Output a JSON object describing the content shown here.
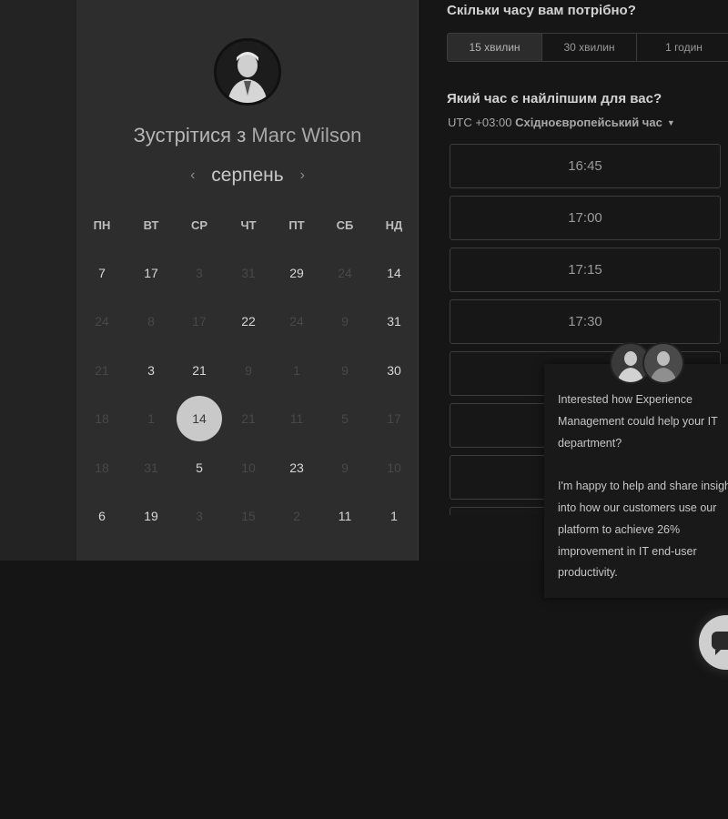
{
  "header": {
    "meet_prefix": "Зустрітися з",
    "host_name": "Marc Wilson"
  },
  "calendar": {
    "month": "серпень",
    "prev_icon": "chevron-left-icon",
    "next_icon": "chevron-right-icon",
    "weekdays": [
      "ПН",
      "ВТ",
      "СР",
      "ЧТ",
      "ПТ",
      "СБ",
      "НД"
    ],
    "weeks": [
      [
        {
          "d": "7",
          "a": true
        },
        {
          "d": "17",
          "a": true
        },
        {
          "d": "3",
          "a": false
        },
        {
          "d": "31",
          "a": false
        },
        {
          "d": "29",
          "a": true
        },
        {
          "d": "24",
          "a": false
        },
        {
          "d": "14",
          "a": true
        }
      ],
      [
        {
          "d": "24",
          "a": false
        },
        {
          "d": "8",
          "a": false
        },
        {
          "d": "17",
          "a": false
        },
        {
          "d": "22",
          "a": true
        },
        {
          "d": "24",
          "a": false
        },
        {
          "d": "9",
          "a": false
        },
        {
          "d": "31",
          "a": true
        }
      ],
      [
        {
          "d": "21",
          "a": false
        },
        {
          "d": "3",
          "a": true
        },
        {
          "d": "21",
          "a": true
        },
        {
          "d": "9",
          "a": false
        },
        {
          "d": "1",
          "a": false
        },
        {
          "d": "9",
          "a": false
        },
        {
          "d": "30",
          "a": true
        }
      ],
      [
        {
          "d": "18",
          "a": false
        },
        {
          "d": "1",
          "a": false
        },
        {
          "d": "14",
          "a": true,
          "selected": true
        },
        {
          "d": "21",
          "a": false
        },
        {
          "d": "11",
          "a": false
        },
        {
          "d": "5",
          "a": false
        },
        {
          "d": "17",
          "a": false
        }
      ],
      [
        {
          "d": "18",
          "a": false
        },
        {
          "d": "31",
          "a": false
        },
        {
          "d": "5",
          "a": true
        },
        {
          "d": "10",
          "a": false
        },
        {
          "d": "23",
          "a": true
        },
        {
          "d": "9",
          "a": false
        },
        {
          "d": "10",
          "a": false
        }
      ],
      [
        {
          "d": "6",
          "a": true
        },
        {
          "d": "19",
          "a": true
        },
        {
          "d": "3",
          "a": false
        },
        {
          "d": "15",
          "a": false
        },
        {
          "d": "2",
          "a": false
        },
        {
          "d": "11",
          "a": true
        },
        {
          "d": "1",
          "a": true
        }
      ]
    ]
  },
  "booking": {
    "duration_question": "Скільки часу вам потрібно?",
    "durations": [
      "15 хвилин",
      "30 хвилин",
      "1 годин"
    ],
    "selected_duration": "15 хвилин",
    "time_question": "Який час є найліпшим для вас?",
    "tz_offset": "UTC +03:00",
    "tz_name": "Східноєвропейський час",
    "slots": [
      "16:45",
      "17:00",
      "17:15",
      "17:30",
      "",
      "",
      "",
      ""
    ]
  },
  "chat": {
    "message": "Interested how Experience Management could help your IT department?\n\nI'm happy to help and share insight into how our customers use our platform to achieve 26% improvement in IT end-user productivity.",
    "launcher_icon": "chat-bubble-icon"
  },
  "colors": {
    "selected_day_bg": "#c9c9c9",
    "panel_bg": "#2d2d2d",
    "right_bg": "#161616"
  }
}
